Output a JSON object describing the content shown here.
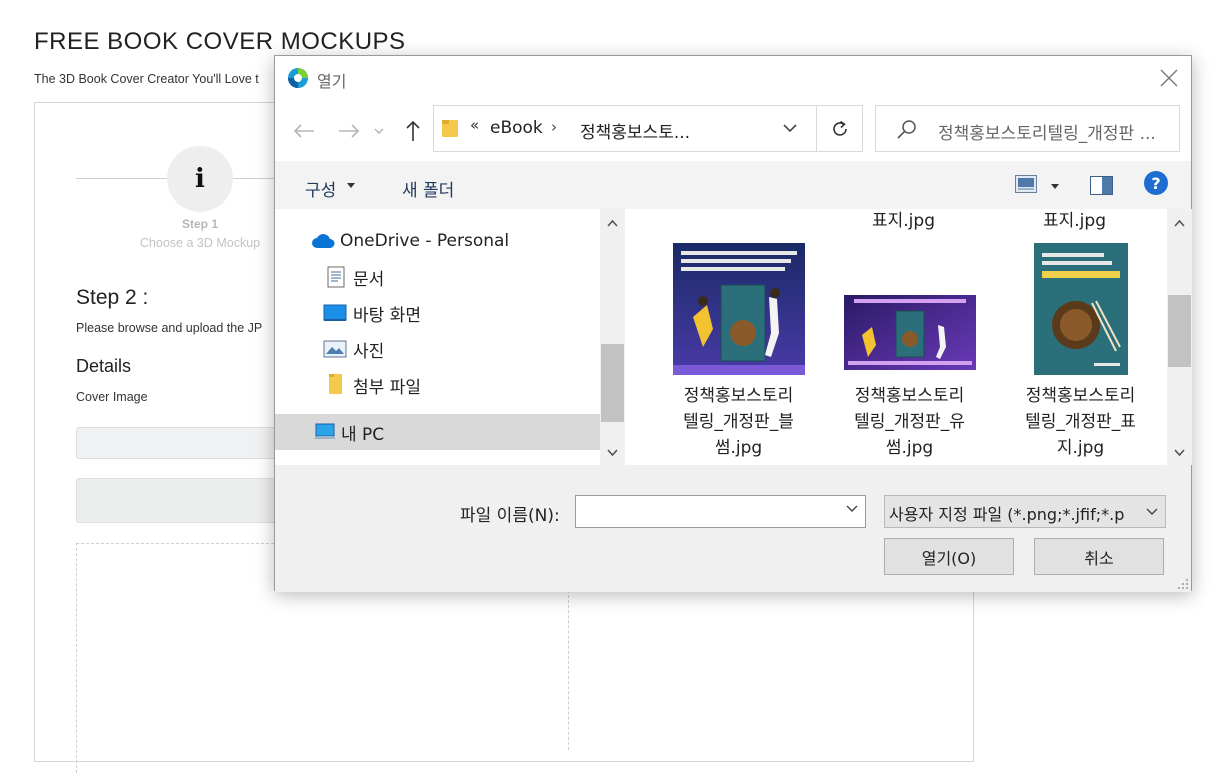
{
  "page": {
    "title": "FREE BOOK COVER MOCKUPS",
    "subtitle": "The 3D Book Cover Creator You'll Love t",
    "step1": {
      "icon": "i",
      "num": "Step 1",
      "desc": "Choose a 3D Mockup"
    },
    "step2": {
      "title": "Step 2 :",
      "desc": "Please browse and upload the JP"
    },
    "details": "Details",
    "cover_image_label": "Cover Image"
  },
  "dialog": {
    "title": "열기",
    "address": {
      "overflow": "«",
      "seg1": "eBook",
      "sep": "›",
      "seg2": "정책홍보스토..."
    },
    "search_placeholder": "정책홍보스토리텔링_개정판 ...",
    "toolbar": {
      "organize": "구성",
      "new_folder": "새 폴더",
      "help": "?"
    },
    "nav_items": [
      {
        "label": "OneDrive - Personal",
        "icon": "onedrive-cloud-icon"
      },
      {
        "label": "문서",
        "icon": "documents-icon"
      },
      {
        "label": "바탕 화면",
        "icon": "desktop-icon"
      },
      {
        "label": "사진",
        "icon": "pictures-icon"
      },
      {
        "label": "첨부 파일",
        "icon": "folder-icon"
      },
      {
        "label": "내 PC",
        "icon": "this-pc-icon"
      }
    ],
    "files_top": [
      "표지.jpg",
      "표지.jpg"
    ],
    "files": [
      {
        "name": "정책홍보스토리텔링_개정판_블썸.jpg",
        "line1": "정책홍보스토리",
        "line2": "텔링_개정판_블",
        "line3": "썸.jpg"
      },
      {
        "name": "정책홍보스토리텔링_개정판_유썸.jpg",
        "line1": "정책홍보스토리",
        "line2": "텔링_개정판_유",
        "line3": "썸.jpg"
      },
      {
        "name": "정책홍보스토리텔링_개정판_표지.jpg",
        "line1": "정책홍보스토리",
        "line2": "텔링_개정판_표",
        "line3": "지.jpg"
      }
    ],
    "filename_label": "파일 이름(N):",
    "filename_value": "",
    "filetype": "사용자 지정 파일 (*.png;*.jfif;*.p",
    "open_button": "열기(O)",
    "cancel_button": "취소"
  },
  "colors": {
    "accent": "#1d6ed0",
    "folder": "#f3c84b"
  }
}
